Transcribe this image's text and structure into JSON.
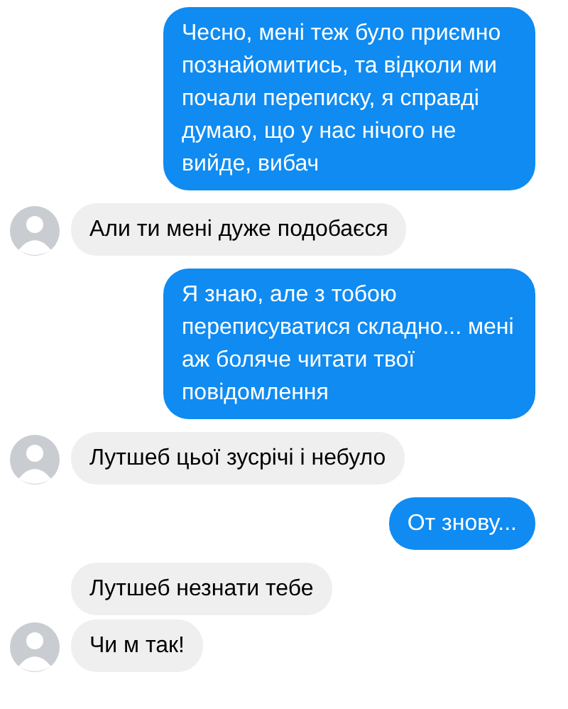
{
  "messages": [
    {
      "kind": "sent",
      "text": "Чесно, мені теж було приємно познайомитись, та відколи ми почали переписку, я справді думаю, що у нас нічого не вийде, вибач"
    },
    {
      "kind": "received",
      "avatar": true,
      "text": "Али ти мені дуже подобаєся"
    },
    {
      "kind": "sent",
      "text": "Я знаю, але з тобою переписуватися складно... мені аж боляче читати твої повідомлення"
    },
    {
      "kind": "received",
      "avatar": true,
      "text": "Лутшеб цьої зусрічі і небуло"
    },
    {
      "kind": "sent",
      "text": "От знову..."
    },
    {
      "kind": "received",
      "avatar": false,
      "text": "Лутшеб незнати тебе"
    },
    {
      "kind": "received",
      "avatar": true,
      "text": "Чи м так!"
    }
  ]
}
